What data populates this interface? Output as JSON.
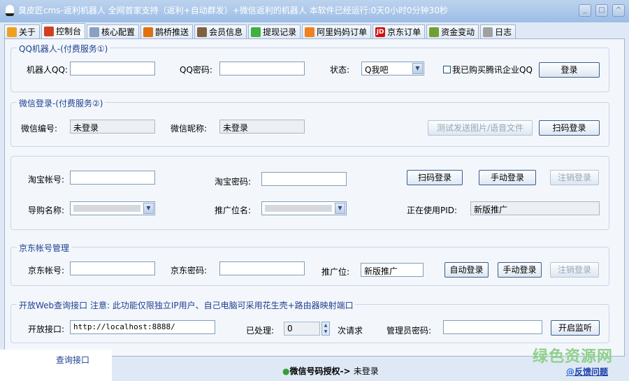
{
  "window": {
    "title": "臭皮匠cms-返利机器人 全网首家支持（返利+自动群发）+微信返利的机器人 本软件已经运行:0天0小时0分钟30秒"
  },
  "tabs": [
    {
      "label": "关于",
      "icon": "home-icon"
    },
    {
      "label": "控制台",
      "icon": "shield-icon"
    },
    {
      "label": "核心配置",
      "icon": "config-icon"
    },
    {
      "label": "鹊桥推送",
      "icon": "clock-icon"
    },
    {
      "label": "会员信息",
      "icon": "user-icon"
    },
    {
      "label": "提现记录",
      "icon": "check-icon"
    },
    {
      "label": "阿里妈妈订单",
      "icon": "alimama-icon"
    },
    {
      "label": "京东订单",
      "icon": "jd-icon"
    },
    {
      "label": "资金变动",
      "icon": "money-icon"
    },
    {
      "label": "日志",
      "icon": "log-icon"
    }
  ],
  "qq": {
    "legend": "QQ机器人-(付费服务①)",
    "robot_label": "机器人QQ:",
    "robot_value": "",
    "pwd_label": "QQ密码:",
    "pwd_value": "",
    "status_label": "状态:",
    "status_value": "Q我吧",
    "enterprise_label": "我已购买腾讯企业QQ",
    "login": "登录"
  },
  "wechat": {
    "legend": "微信登录-(付费服务②)",
    "id_label": "微信编号:",
    "id_value": "未登录",
    "nick_label": "微信昵称:",
    "nick_value": "未登录",
    "test_send": "测试发送图片/语音文件",
    "scan_login": "扫码登录"
  },
  "taobao": {
    "account_label": "淘宝帐号:",
    "pwd_label": "淘宝密码:",
    "scan_login": "扫码登录",
    "manual_login": "手动登录",
    "logout": "注销登录",
    "guide_label": "导购名称:",
    "pid_pos_label": "推广位名:",
    "pid_label": "正在使用PID:",
    "pid_value": "新版推广"
  },
  "jd": {
    "legend": "京东帐号管理",
    "account_label": "京东帐号:",
    "pwd_label": "京东密码:",
    "pos_label": "推广位:",
    "pos_value": "新版推广",
    "auto_login": "自动登录",
    "manual_login": "手动登录",
    "logout": "注销登录"
  },
  "web": {
    "legend": "开放Web查询接口 注意: 此功能仅限独立IP用户、自己电脑可采用花生壳+路由器映射端口",
    "port_label": "开放接口:",
    "port_value": "http://localhost:8888/",
    "processed_label": "已处理:",
    "processed_value": "0",
    "times_label": "次请求",
    "admin_pwd_label": "管理员密码:",
    "start": "开启监听"
  },
  "status": {
    "auth_label": "微信号码授权->",
    "auth_value": "未登录",
    "feedback": "反馈问题"
  },
  "overlay": {
    "text": "查询接口"
  },
  "watermark": "绿色资源网"
}
